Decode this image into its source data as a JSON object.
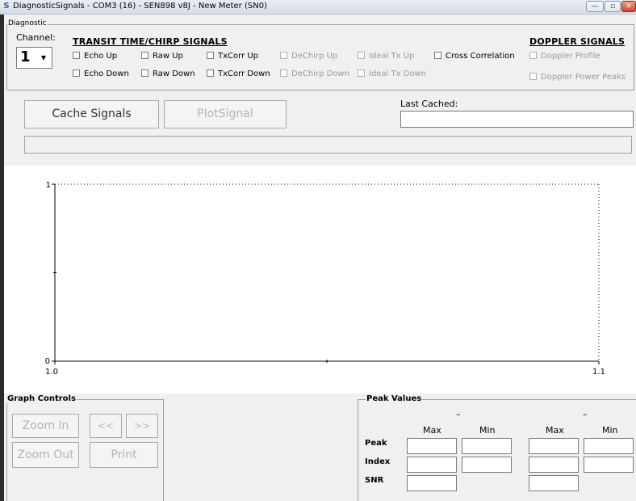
{
  "window": {
    "title": "DiagnosticSignals - COM3 (16) - SEN898 v8J - New Meter (SN0)",
    "minimize": "—",
    "maximize": "▫",
    "close": "✕"
  },
  "diagnostic": {
    "group_label": "Diagnostic",
    "channel_label": "Channel:",
    "channel_value": "1",
    "dropdown_arrow": "▾"
  },
  "transit": {
    "header": "TRANSIT TIME/CHIRP SIGNALS",
    "checkboxes": [
      {
        "label": "Echo Up",
        "enabled": true
      },
      {
        "label": "Raw Up",
        "enabled": true
      },
      {
        "label": "TxCorr Up",
        "enabled": true
      },
      {
        "label": "DeChirp Up",
        "enabled": false
      },
      {
        "label": "Ideal Tx Up",
        "enabled": false
      },
      {
        "label": "Cross Correlation",
        "enabled": true
      },
      {
        "label": "Echo Down",
        "enabled": true
      },
      {
        "label": "Raw Down",
        "enabled": true
      },
      {
        "label": "TxCorr Down",
        "enabled": true
      },
      {
        "label": "DeChirp Down",
        "enabled": false
      },
      {
        "label": "Ideal Tx Down",
        "enabled": false
      }
    ]
  },
  "doppler": {
    "header": "DOPPLER SIGNALS",
    "checkboxes": [
      {
        "label": "Doppler Profile",
        "enabled": false
      },
      {
        "label": "Doppler Power Peaks",
        "enabled": false
      }
    ]
  },
  "actions": {
    "cache_signals": "Cache Signals",
    "plot_signal": "PlotSignal",
    "last_cached_label": "Last Cached:",
    "last_cached_value": ""
  },
  "chart_data": {
    "type": "line",
    "series": [],
    "xlim": [
      1.0,
      1.1
    ],
    "ylim": [
      0,
      1
    ],
    "x_tick_labels": [
      "1.0",
      "1.1"
    ],
    "y_tick_labels": [
      "0",
      "1"
    ],
    "grid": false
  },
  "graph_controls": {
    "group_label": "Graph Controls",
    "zoom_in": "Zoom In",
    "zoom_out": "Zoom Out",
    "prev": "<<",
    "next": ">>",
    "print": "Print"
  },
  "peak_values": {
    "group_label": "Peak Values",
    "dash_left": "–",
    "dash_right": "–",
    "col_max": "Max",
    "col_min": "Min",
    "rows": [
      "Peak",
      "Index",
      "SNR"
    ]
  }
}
